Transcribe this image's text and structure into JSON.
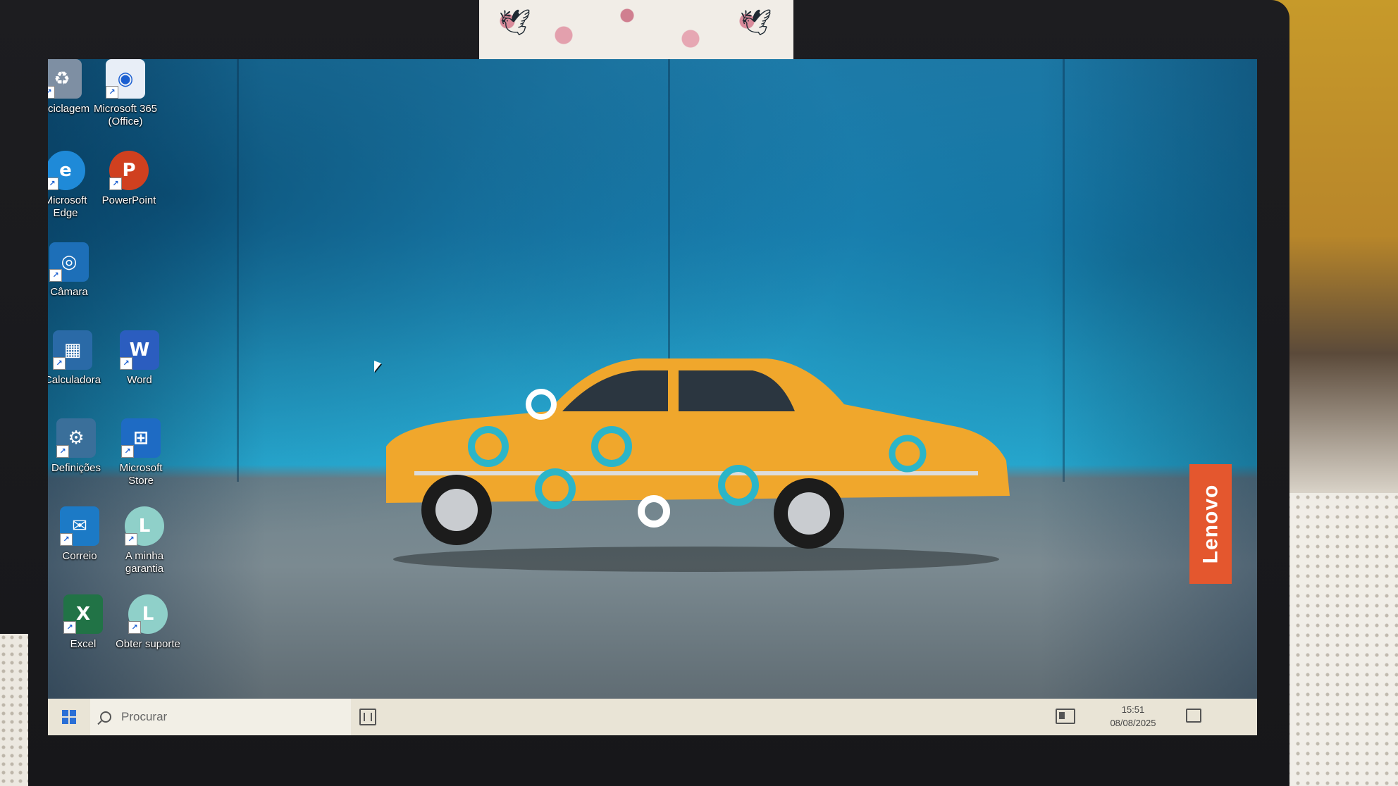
{
  "desktop": {
    "icons": [
      {
        "label": "Reciclagem",
        "icon": "recycle-bin-icon",
        "color": "#7e8fa3"
      },
      {
        "label": "Microsoft 365 (Office)",
        "icon": "office-icon",
        "color": "#e8eef7"
      },
      {
        "label": "Microsoft Edge",
        "icon": "edge-icon",
        "color": "#1f8ad8"
      },
      {
        "label": "PowerPoint",
        "icon": "powerpoint-icon",
        "color": "#d0401f"
      },
      {
        "label": "Câmara",
        "icon": "camera-icon",
        "color": "#1d6fb8"
      },
      {
        "label": "Calculadora",
        "icon": "calculator-icon",
        "color": "#2a6aa7"
      },
      {
        "label": "Word",
        "icon": "word-icon",
        "color": "#2b5dbf"
      },
      {
        "label": "Definições",
        "icon": "gear-icon",
        "color": "#3a6f9a"
      },
      {
        "label": "Microsoft Store",
        "icon": "store-icon",
        "color": "#1e6bc4"
      },
      {
        "label": "Correio",
        "icon": "mail-icon",
        "color": "#1c7ac6"
      },
      {
        "label": "A minha garantia",
        "icon": "warranty-icon",
        "color": "#8fd0c9"
      },
      {
        "label": "Excel",
        "icon": "excel-icon",
        "color": "#217346"
      },
      {
        "label": "Obter suporte",
        "icon": "support-icon",
        "color": "#8fd0c9"
      }
    ]
  },
  "wallpaper": {
    "brand": "Lenovo",
    "accent": "#e4572e"
  },
  "taskbar": {
    "search_placeholder": "Procurar",
    "time": "15:51",
    "date": "08/08/2025"
  }
}
